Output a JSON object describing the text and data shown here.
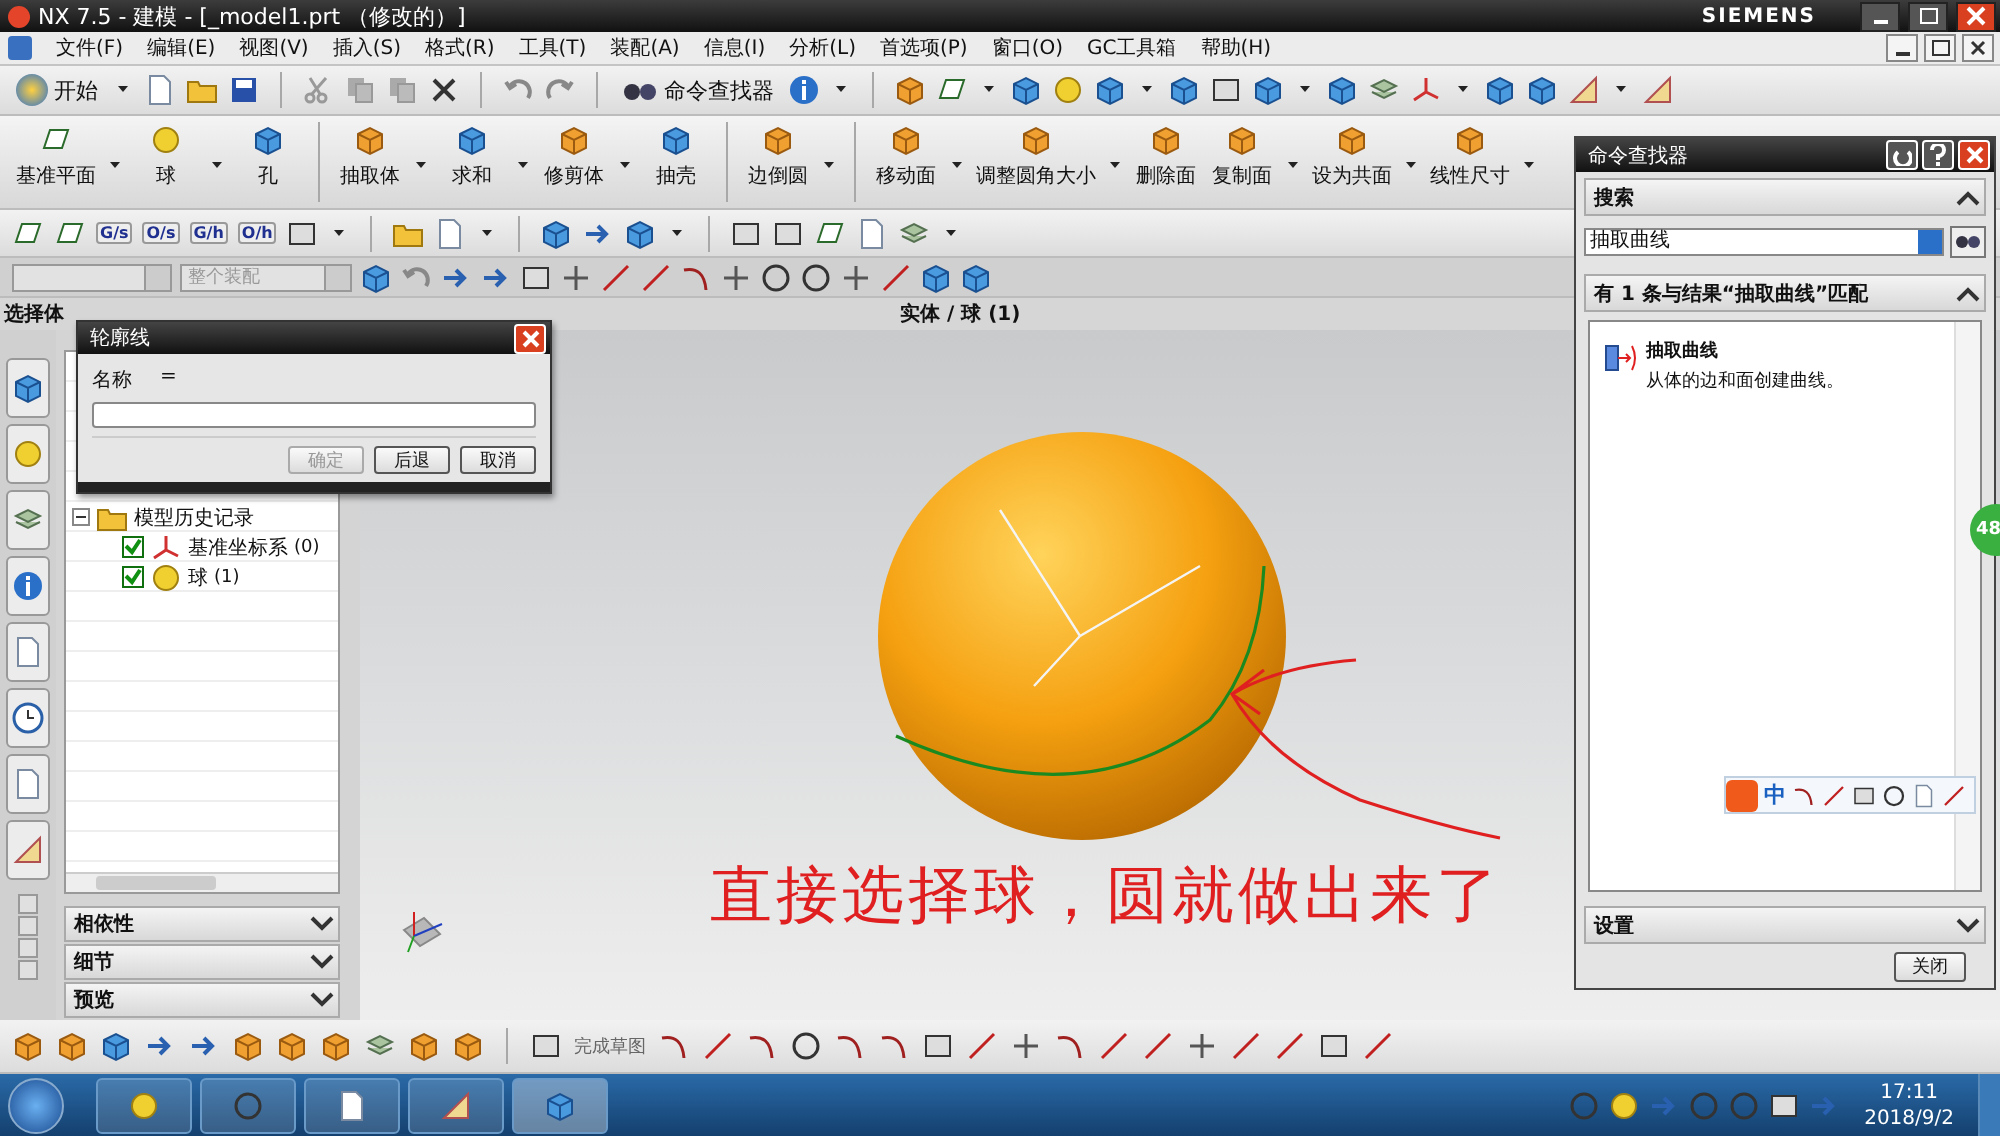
{
  "window": {
    "title": "NX 7.5 - 建模 - [_model1.prt （修改的）]",
    "brand": "SIEMENS"
  },
  "menu": [
    "文件(F)",
    "编辑(E)",
    "视图(V)",
    "插入(S)",
    "格式(R)",
    "工具(T)",
    "装配(A)",
    "信息(I)",
    "分析(L)",
    "首选项(P)",
    "窗口(O)",
    "GC工具箱",
    "帮助(H)"
  ],
  "standard_toolbar": {
    "start": "开始",
    "command_finder": "命令查找器"
  },
  "feature_toolbar": [
    {
      "label": "基准平面",
      "dropdown": true
    },
    {
      "label": "球",
      "dropdown": true
    },
    {
      "label": "孔",
      "dropdown": false
    },
    {
      "label": "抽取体",
      "dropdown": true
    },
    {
      "label": "求和",
      "dropdown": true
    },
    {
      "label": "修剪体",
      "dropdown": true
    },
    {
      "label": "抽壳",
      "dropdown": false
    },
    {
      "label": "边倒圆",
      "dropdown": true
    },
    {
      "label": "移动面",
      "dropdown": true
    },
    {
      "label": "调整圆角大小",
      "dropdown": true
    },
    {
      "label": "删除面",
      "dropdown": false
    },
    {
      "label": "复制面",
      "dropdown": true
    },
    {
      "label": "设为共面",
      "dropdown": true
    },
    {
      "label": "线性尺寸",
      "dropdown": true
    }
  ],
  "analysis_toolbar": {
    "icon_labels": [
      "G/s",
      "O/s",
      "G/h",
      "O/h"
    ]
  },
  "selection_bar": {
    "scope": {
      "value": "整个装配",
      "disabled": true
    }
  },
  "status": {
    "prompt": "选择体",
    "view_title": "实体 / 球 (1)"
  },
  "navigator": {
    "tree": [
      {
        "label": "模型历史记录",
        "expanded": true,
        "children": [
          {
            "label": "基准坐标系",
            "count": "(0)",
            "checked": true
          },
          {
            "label": "球",
            "count": "(1)",
            "checked": true
          }
        ]
      }
    ],
    "panels": [
      {
        "label": "相依性",
        "expanded": false
      },
      {
        "label": "细节",
        "expanded": false
      },
      {
        "label": "预览",
        "expanded": false
      }
    ]
  },
  "dialog": {
    "title": "轮廓线",
    "name_label": "名称",
    "equals": "=",
    "buttons": [
      {
        "label": "确定",
        "disabled": true
      },
      {
        "label": "后退",
        "disabled": false
      },
      {
        "label": "取消",
        "disabled": false
      }
    ]
  },
  "annotation": "直接选择球，圆就做出来了",
  "command_finder": {
    "title": "命令查找器",
    "search_header": {
      "label": "搜索",
      "expanded": true
    },
    "query": "抽取曲线",
    "result_header": {
      "label": "有 1 条与结果“抽取曲线”匹配",
      "expanded": true
    },
    "results": [
      {
        "title": "抽取曲线",
        "description": "从体的边和面创建曲线。"
      }
    ],
    "settings_header": {
      "label": "设置",
      "expanded": false
    },
    "close": "关闭"
  },
  "ime_bar": {
    "mode": "中"
  },
  "floating_badge": "48",
  "sketch_toolbar": {
    "finish_sketch": "完成草图"
  },
  "taskbar": {
    "time": "17:11",
    "date": "2018/9/2"
  }
}
